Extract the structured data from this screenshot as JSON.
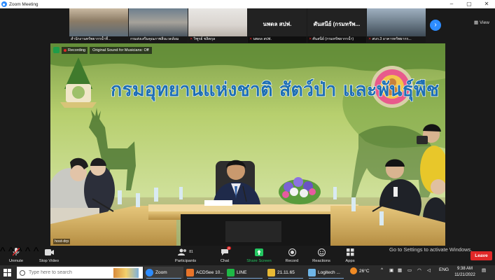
{
  "window": {
    "title": "Zoom Meeting",
    "minimize": "–",
    "maximize": "▢",
    "close": "✕"
  },
  "gallery": {
    "participants": [
      {
        "caption": "สำนักงานทรัพยากรน้ำที่...",
        "muted": false
      },
      {
        "caption": "กรมส่งเสริมคุณภาพสิ่งแวดล้อม",
        "muted": false
      },
      {
        "caption": "วิฑูรย์ ชลิตกุล",
        "muted": true
      },
      {
        "caption": "นพดล สปฟ.",
        "muted": true,
        "name": "นพดล สปฟ."
      },
      {
        "caption": "ศันสนีย์ (กรมทรัพยากรน้ำ)",
        "muted": true,
        "name": "ศันสนีย์ (กรมทรัพ..."
      },
      {
        "caption": "สบก.3 อาคารทรัพยากร...",
        "muted": true
      }
    ],
    "view_label": "View"
  },
  "main_video": {
    "banner_text": "กรมอุทยานแห่งชาติ สัตว์ป่า และพันธุ์พืช",
    "recording_label": "Recording",
    "sound_label": "Original Sound for Musicians: Off",
    "host_label": "host-drp",
    "watermark": "Go to Settings to activate Windows."
  },
  "toolbar": {
    "unmute": "Unmute",
    "stop_video": "Stop Video",
    "participants": "Participants",
    "participants_count": "81",
    "chat": "Chat",
    "chat_badge": "4",
    "share_screen": "Share Screen",
    "record": "Record",
    "reactions": "Reactions",
    "apps": "Apps",
    "leave": "Leave"
  },
  "taskbar": {
    "search_placeholder": "Type here to search",
    "apps": [
      {
        "label": "Zoom",
        "color": "#2d8cff",
        "active": true
      },
      {
        "label": "ACDSee 10...",
        "color": "#e8742a",
        "active": false
      },
      {
        "label": "LINE",
        "color": "#1fb846",
        "active": false
      },
      {
        "label": "21.11.65",
        "color": "#e8b934",
        "active": false
      },
      {
        "label": "Logitech ...",
        "color": "#6fb6e8",
        "active": false
      }
    ],
    "weather": "26°C",
    "language": "ENG",
    "time": "9:38 AM",
    "date": "11/21/2022"
  }
}
